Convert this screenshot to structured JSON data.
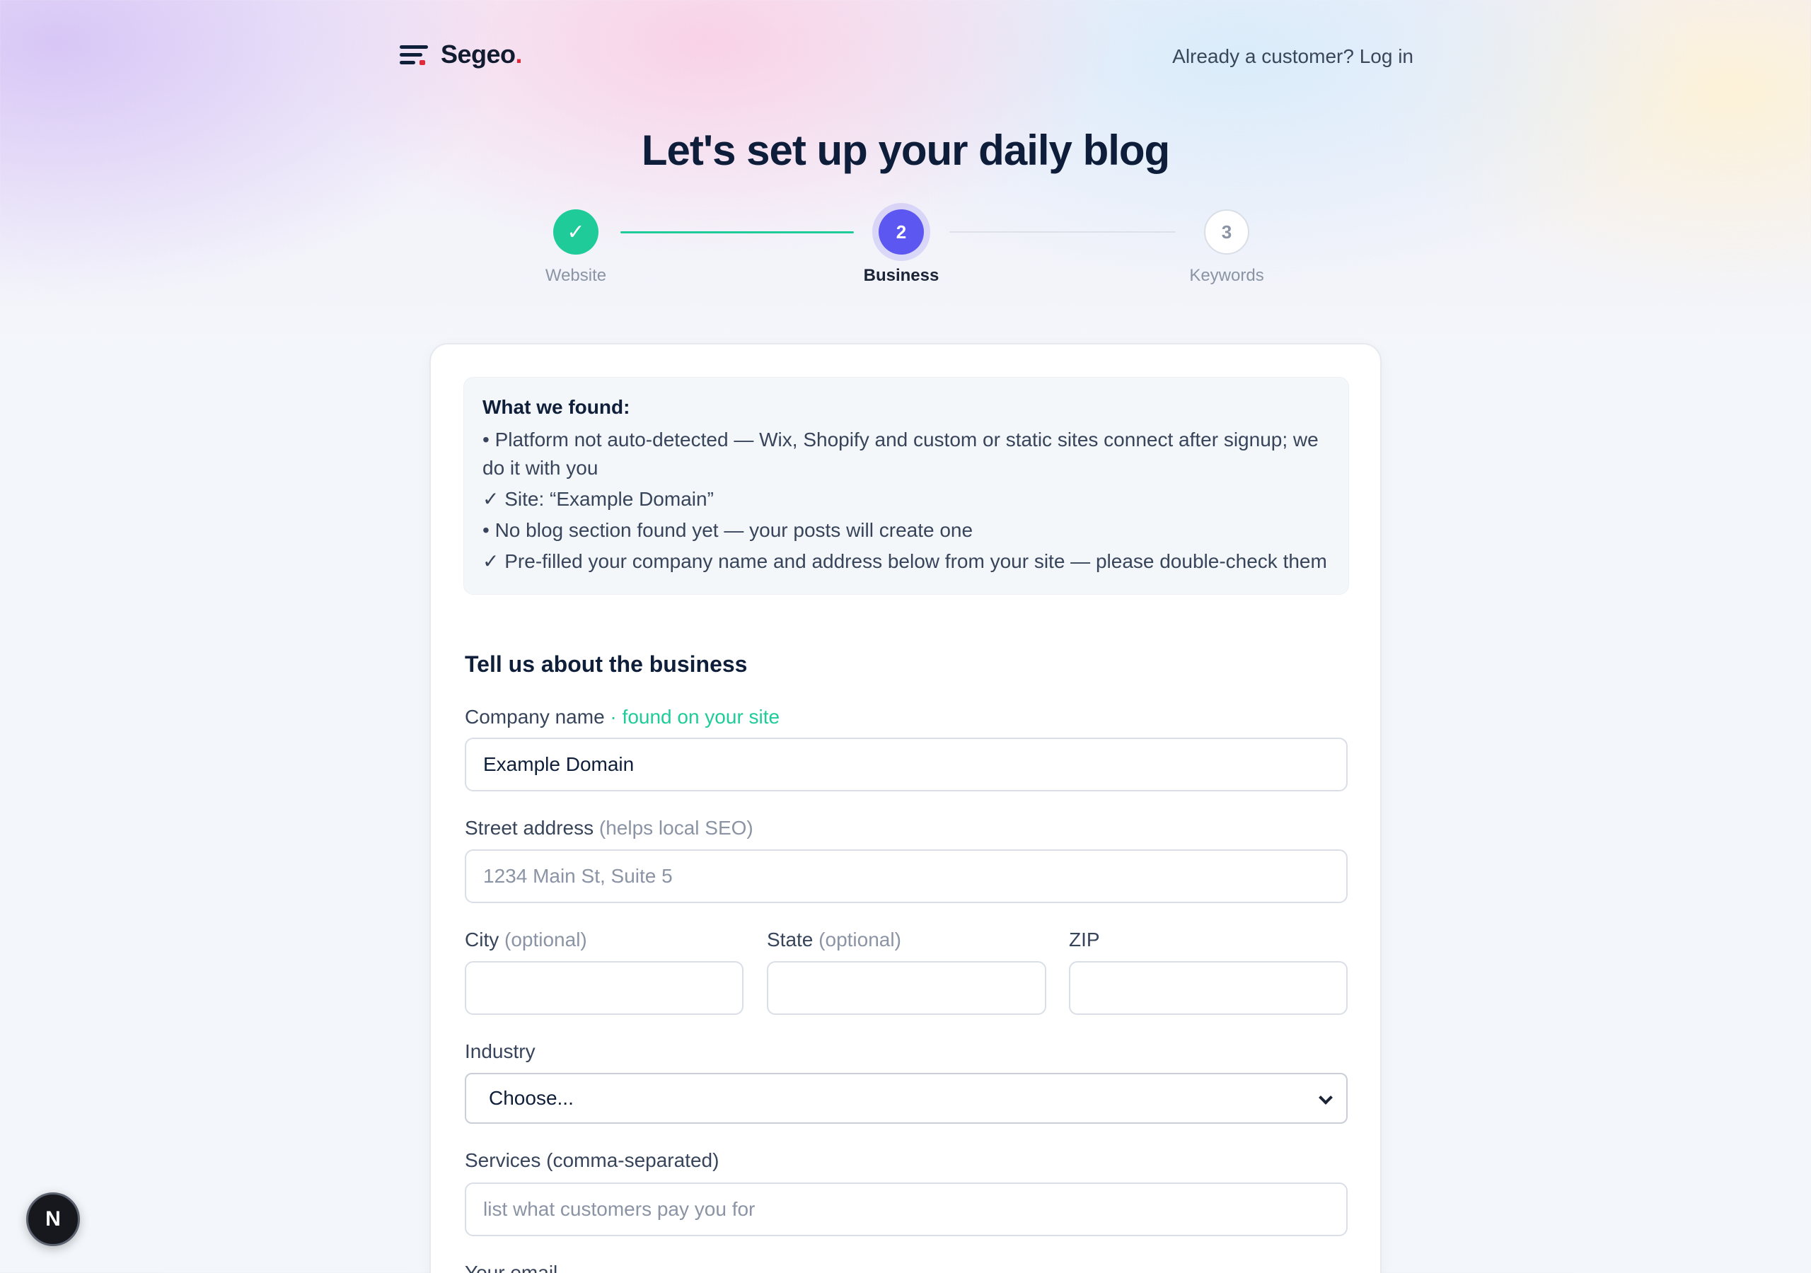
{
  "header": {
    "brand": "Segeo",
    "brand_period": ".",
    "login_link": "Already a customer? Log in"
  },
  "page_title": "Let's set up your daily blog",
  "stepper": {
    "steps": [
      {
        "label": "Website",
        "marker": "✓",
        "state": "done"
      },
      {
        "label": "Business",
        "marker": "2",
        "state": "active"
      },
      {
        "label": "Keywords",
        "marker": "3",
        "state": "todo"
      }
    ]
  },
  "found": {
    "title": "What we found:",
    "items": [
      "• Platform not auto-detected — Wix, Shopify and custom or static sites connect after signup; we do it with you",
      "✓ Site: “Example Domain”",
      "• No blog section found yet — your posts will create one",
      "✓ Pre-filled your company name and address below from your site — please double-check them"
    ]
  },
  "form": {
    "section_title": "Tell us about the business",
    "company": {
      "label": "Company name",
      "hint": " · found on your site",
      "value": "Example Domain"
    },
    "street": {
      "label": "Street address",
      "hint": " (helps local SEO)",
      "placeholder": "1234 Main St, Suite 5"
    },
    "city": {
      "label": "City",
      "hint": " (optional)",
      "value": ""
    },
    "state": {
      "label": "State",
      "hint": " (optional)",
      "value": ""
    },
    "zip": {
      "label": "ZIP",
      "value": ""
    },
    "industry": {
      "label": "Industry",
      "selected": "Choose..."
    },
    "services": {
      "label": "Services (comma-separated)",
      "placeholder": "list what customers pay you for"
    },
    "email": {
      "label": "Your email"
    }
  },
  "badge": {
    "letter": "N"
  },
  "colors": {
    "accent": "#5b57f0",
    "success": "#1fcc99",
    "brand_red": "#e02a3a",
    "text": "#0f1f3a"
  }
}
